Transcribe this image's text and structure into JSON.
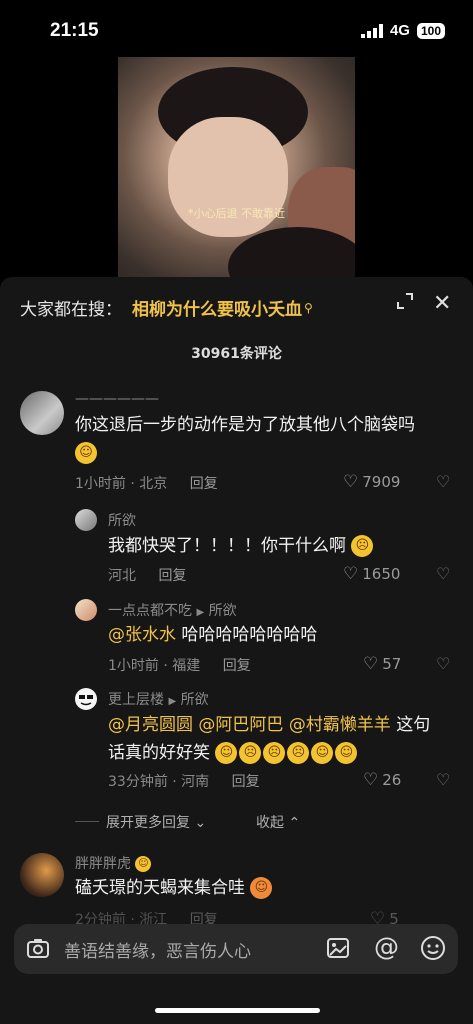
{
  "status": {
    "time": "21:15",
    "network": "4G",
    "battery": "100"
  },
  "video": {
    "subtitle": "*小心后退  不敢靠近"
  },
  "search": {
    "prefix": "大家都在搜：",
    "term": "相柳为什么要吸小夭血"
  },
  "comments_count": "30961条评论",
  "comments": [
    {
      "name": "——————",
      "text": "你这退后一步的动作是为了放其他八个脑袋吗",
      "meta": "1小时前 · 北京",
      "reply_label": "回复",
      "likes": "7909"
    },
    {
      "name": "所欲",
      "text": "我都快哭了！！！！你干什么啊",
      "meta": "河北",
      "reply_label": "回复",
      "likes": "1650"
    },
    {
      "name": "一点点都不吃",
      "reply_to": "所欲",
      "mention": "@张水水",
      "text": " 哈哈哈哈哈哈哈哈",
      "meta": "1小时前 · 福建",
      "reply_label": "回复",
      "likes": "57"
    },
    {
      "name": "更上层楼",
      "reply_to": "所欲",
      "mention1": "@月亮圆圆",
      "mention2": "@阿巴阿巴",
      "mention3": "@村霸懒羊羊",
      "text1": " 这句",
      "text2": "话真的好好笑",
      "meta": "33分钟前 · 河南",
      "reply_label": "回复",
      "likes": "26"
    },
    {
      "name": "胖胖胖虎",
      "text": "磕夭璟的天蝎来集合哇",
      "meta": "2分钟前 · 浙江",
      "reply_label": "回复",
      "likes": "5"
    }
  ],
  "expand_more": "展开更多回复",
  "collapse": "收起",
  "input": {
    "placeholder": "善语结善缘，恶言伤人心"
  }
}
